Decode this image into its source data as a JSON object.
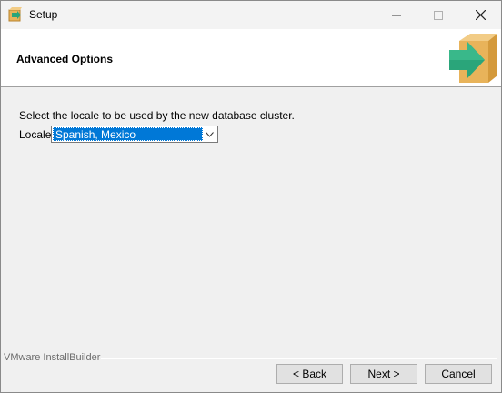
{
  "window": {
    "title": "Setup"
  },
  "header": {
    "title": "Advanced Options"
  },
  "content": {
    "prompt": "Select the locale to be used by the new database cluster.",
    "locale_label": "Locale",
    "locale_value": "Spanish, Mexico"
  },
  "footer": {
    "brand": "VMware InstallBuilder",
    "back_label": "< Back",
    "next_label": "Next >",
    "cancel_label": "Cancel"
  },
  "colors": {
    "selection": "#0078d7",
    "box": "#e8b35a",
    "arrow": "#2aa57a"
  }
}
